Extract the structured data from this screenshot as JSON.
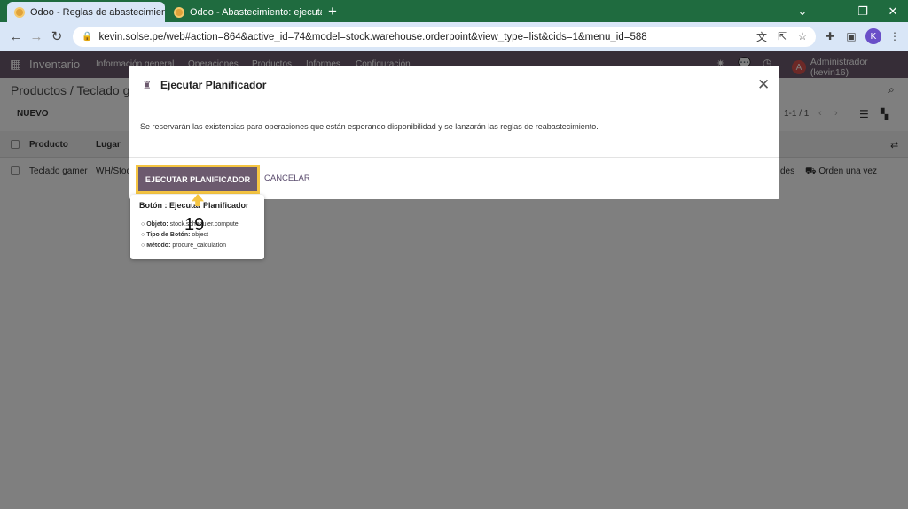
{
  "browser": {
    "tabs": [
      {
        "title": "Odoo - Reglas de abastecimiento",
        "active": true
      },
      {
        "title": "Odoo - Abastecimiento: ejecutar",
        "active": false
      }
    ],
    "url": "kevin.solse.pe/web#action=864&active_id=74&model=stock.warehouse.orderpoint&view_type=list&cids=1&menu_id=588",
    "profile_initial": "K"
  },
  "odoo": {
    "app_name": "Inventario",
    "menu": [
      "Información general",
      "Operaciones",
      "Productos",
      "Informes",
      "Configuración"
    ],
    "user": {
      "initial": "A",
      "name": "Administrador (kevin16)"
    },
    "breadcrumb": "Productos / Teclado ga",
    "new_button": "NUEVO",
    "pager": "1-1 / 1",
    "columns": {
      "product": "Producto",
      "location": "Lugar"
    },
    "row": {
      "product": "Teclado gamer",
      "location": "WH/Stoc",
      "units_tail": "des",
      "action": "Orden una vez"
    }
  },
  "modal": {
    "title": "Ejecutar Planificador",
    "body": "Se reservarán las existencias para operaciones que están esperando disponibilidad y se lanzarán las reglas de reabastecimiento.",
    "primary_button": "EJECUTAR PLANIFICADOR",
    "cancel_button": "CANCELAR"
  },
  "tooltip": {
    "title": "Botón : Ejecutar Planificador",
    "objeto_label": "Objeto:",
    "objeto_value": "stock.scheduler.compute",
    "tipo_label": "Tipo de Botón:",
    "tipo_value": "object",
    "metodo_label": "Método:",
    "metodo_value": "procure_calculation"
  },
  "step_marker": "19",
  "colors": {
    "brand": "#6c5a6e",
    "highlight": "#f5c542",
    "tabbar": "#1f6b3f"
  }
}
